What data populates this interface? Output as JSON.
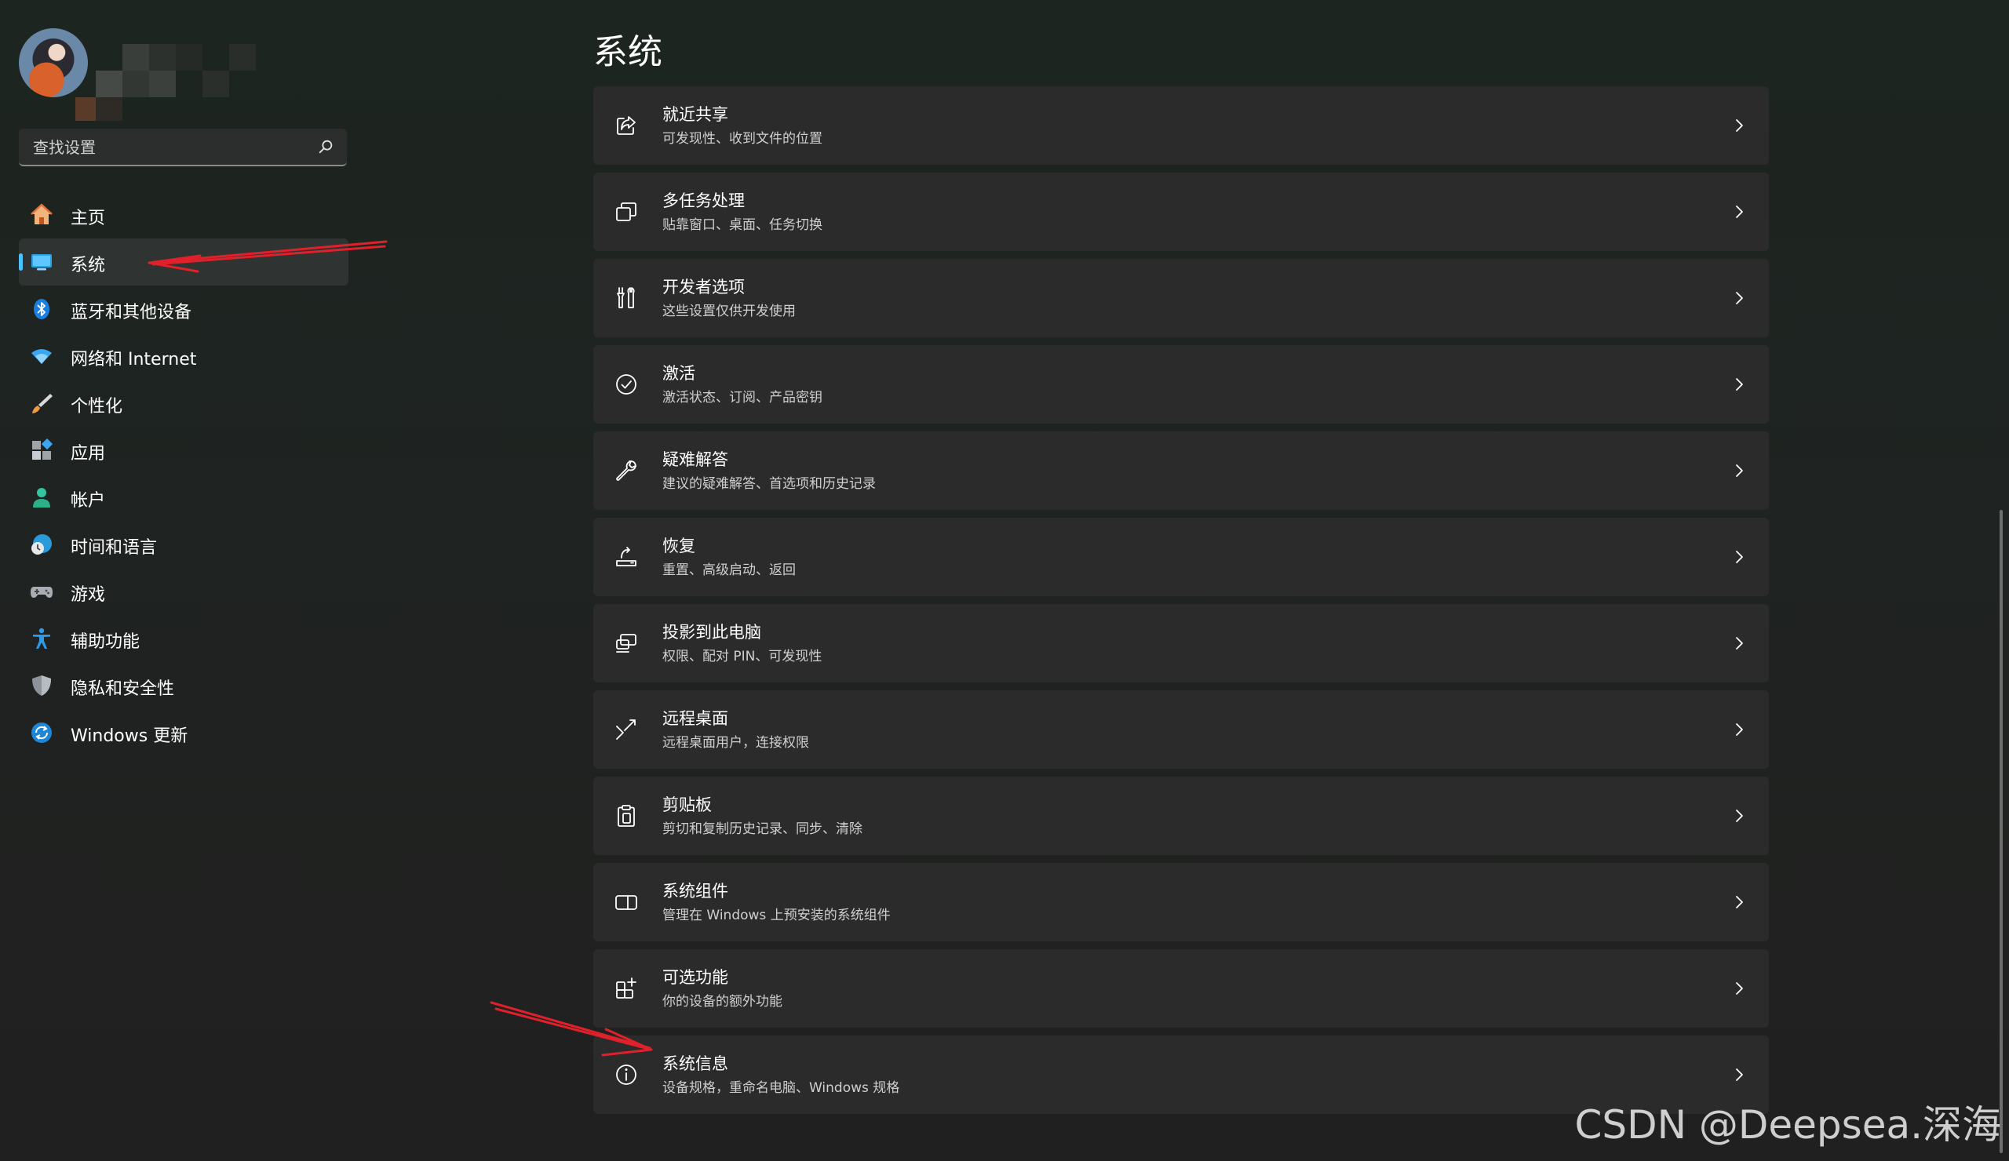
{
  "search": {
    "placeholder": "查找设置"
  },
  "sidebar": {
    "items": [
      {
        "label": "主页",
        "icon": "home-icon"
      },
      {
        "label": "系统",
        "icon": "monitor-icon",
        "active": true
      },
      {
        "label": "蓝牙和其他设备",
        "icon": "bluetooth-icon"
      },
      {
        "label": "网络和 Internet",
        "icon": "wifi-icon"
      },
      {
        "label": "个性化",
        "icon": "brush-icon"
      },
      {
        "label": "应用",
        "icon": "apps-icon"
      },
      {
        "label": "帐户",
        "icon": "person-icon"
      },
      {
        "label": "时间和语言",
        "icon": "clock-globe-icon"
      },
      {
        "label": "游戏",
        "icon": "gamepad-icon"
      },
      {
        "label": "辅助功能",
        "icon": "accessibility-icon"
      },
      {
        "label": "隐私和安全性",
        "icon": "shield-icon"
      },
      {
        "label": "Windows 更新",
        "icon": "sync-icon"
      }
    ]
  },
  "main": {
    "title": "系统",
    "cards": [
      {
        "title": "就近共享",
        "desc": "可发现性、收到文件的位置",
        "icon": "share-icon"
      },
      {
        "title": "多任务处理",
        "desc": "贴靠窗口、桌面、任务切换",
        "icon": "multitask-icon"
      },
      {
        "title": "开发者选项",
        "desc": "这些设置仅供开发使用",
        "icon": "developer-tools-icon"
      },
      {
        "title": "激活",
        "desc": "激活状态、订阅、产品密钥",
        "icon": "check-circle-icon"
      },
      {
        "title": "疑难解答",
        "desc": "建议的疑难解答、首选项和历史记录",
        "icon": "wrench-icon"
      },
      {
        "title": "恢复",
        "desc": "重置、高级启动、返回",
        "icon": "recovery-icon"
      },
      {
        "title": "投影到此电脑",
        "desc": "权限、配对 PIN、可发现性",
        "icon": "project-icon"
      },
      {
        "title": "远程桌面",
        "desc": "远程桌面用户，连接权限",
        "icon": "remote-desktop-icon"
      },
      {
        "title": "剪贴板",
        "desc": "剪切和复制历史记录、同步、清除",
        "icon": "clipboard-icon"
      },
      {
        "title": "系统组件",
        "desc": "管理在 Windows 上预安装的系统组件",
        "icon": "components-icon"
      },
      {
        "title": "可选功能",
        "desc": "你的设备的额外功能",
        "icon": "add-apps-icon"
      },
      {
        "title": "系统信息",
        "desc": "设备规格，重命名电脑、Windows 规格",
        "icon": "info-icon"
      }
    ]
  },
  "watermark": "CSDN @Deepsea.深海",
  "colors": {
    "accent": "#4cc2ff",
    "card_bg": "#2b2b2b",
    "annotation_arrow": "#e0202a"
  }
}
